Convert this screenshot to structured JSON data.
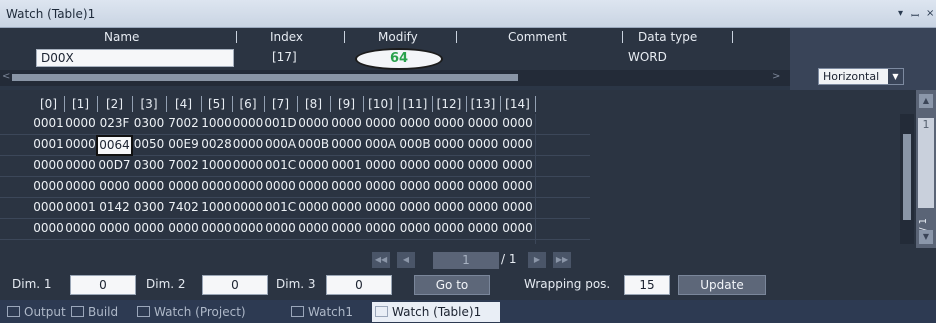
{
  "window": {
    "title": "Watch (Table)1",
    "controls": [
      "▾",
      "ꟷ",
      "×"
    ]
  },
  "header": {
    "columns": {
      "name": "Name",
      "index": "Index",
      "modify": "Modify",
      "comment": "Comment",
      "data_type": "Data type"
    }
  },
  "row": {
    "name": "D00X",
    "index": "[17]",
    "modify": "64",
    "comment": "",
    "data_type": "WORD"
  },
  "orientation": {
    "value": "Horizontal"
  },
  "table": {
    "columns": [
      "[0]",
      "[1]",
      "[2]",
      "[3]",
      "[4]",
      "[5]",
      "[6]",
      "[7]",
      "[8]",
      "[9]",
      "[10]",
      "[11]",
      "[12]",
      "[13]",
      "[14]"
    ],
    "rows": [
      [
        "0001",
        "0000",
        "023F",
        "0300",
        "7002",
        "1000",
        "0000",
        "001D",
        "0000",
        "0000",
        "0000",
        "0000",
        "0000",
        "0000",
        "0000"
      ],
      [
        "0001",
        "0000",
        "0064",
        "0050",
        "00E9",
        "0028",
        "0000",
        "000A",
        "000B",
        "0000",
        "000A",
        "000B",
        "0000",
        "0000",
        "0000"
      ],
      [
        "0000",
        "0000",
        "00D7",
        "0300",
        "7002",
        "1000",
        "0000",
        "001C",
        "0000",
        "0001",
        "0000",
        "0000",
        "0000",
        "0000",
        "0000"
      ],
      [
        "0000",
        "0000",
        "0000",
        "0000",
        "0000",
        "0000",
        "0000",
        "0000",
        "0000",
        "0000",
        "0000",
        "0000",
        "0000",
        "0000",
        "0000"
      ],
      [
        "0000",
        "0001",
        "0142",
        "0300",
        "7402",
        "1000",
        "0000",
        "001C",
        "0000",
        "0000",
        "0000",
        "0000",
        "0000",
        "0000",
        "0000"
      ],
      [
        "0000",
        "0000",
        "0000",
        "0000",
        "0000",
        "0000",
        "0000",
        "0000",
        "0000",
        "0000",
        "0000",
        "0000",
        "0000",
        "0000",
        "0000"
      ]
    ],
    "selected": {
      "row": 1,
      "col": 2
    }
  },
  "side_pager": {
    "label": "/ 1",
    "value": "1"
  },
  "pager": {
    "page": "1",
    "total": "/ 1"
  },
  "dims": {
    "dim1_label": "Dim. 1",
    "dim1": "0",
    "dim2_label": "Dim. 2",
    "dim2": "0",
    "dim3_label": "Dim. 3",
    "dim3": "0"
  },
  "actions": {
    "goto": "Go to",
    "wrapping_label": "Wrapping pos.",
    "wrapping": "15",
    "update": "Update"
  },
  "tabs": [
    "Output",
    "Build",
    "Watch (Project)",
    "Watch1",
    "Watch (Table)1"
  ],
  "colors": {
    "accent_green": "#2aa14c",
    "panel": "#2b3442",
    "active_tab": "#e9eef6"
  }
}
